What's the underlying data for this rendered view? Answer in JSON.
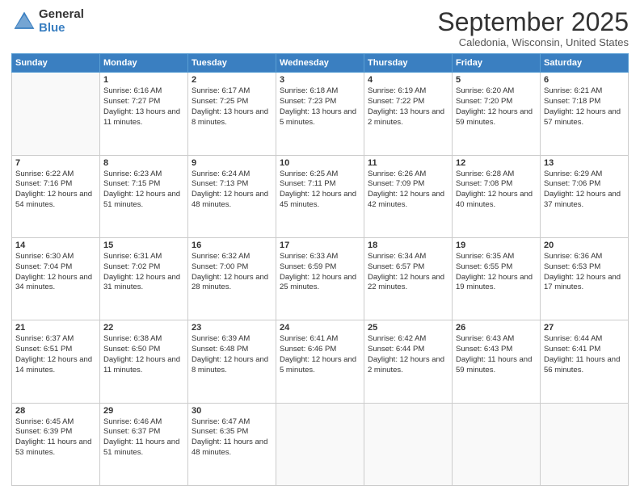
{
  "logo": {
    "general": "General",
    "blue": "Blue"
  },
  "title": "September 2025",
  "location": "Caledonia, Wisconsin, United States",
  "days_header": [
    "Sunday",
    "Monday",
    "Tuesday",
    "Wednesday",
    "Thursday",
    "Friday",
    "Saturday"
  ],
  "weeks": [
    [
      {
        "num": "",
        "sunrise": "",
        "sunset": "",
        "daylight": ""
      },
      {
        "num": "1",
        "sunrise": "Sunrise: 6:16 AM",
        "sunset": "Sunset: 7:27 PM",
        "daylight": "Daylight: 13 hours and 11 minutes."
      },
      {
        "num": "2",
        "sunrise": "Sunrise: 6:17 AM",
        "sunset": "Sunset: 7:25 PM",
        "daylight": "Daylight: 13 hours and 8 minutes."
      },
      {
        "num": "3",
        "sunrise": "Sunrise: 6:18 AM",
        "sunset": "Sunset: 7:23 PM",
        "daylight": "Daylight: 13 hours and 5 minutes."
      },
      {
        "num": "4",
        "sunrise": "Sunrise: 6:19 AM",
        "sunset": "Sunset: 7:22 PM",
        "daylight": "Daylight: 13 hours and 2 minutes."
      },
      {
        "num": "5",
        "sunrise": "Sunrise: 6:20 AM",
        "sunset": "Sunset: 7:20 PM",
        "daylight": "Daylight: 12 hours and 59 minutes."
      },
      {
        "num": "6",
        "sunrise": "Sunrise: 6:21 AM",
        "sunset": "Sunset: 7:18 PM",
        "daylight": "Daylight: 12 hours and 57 minutes."
      }
    ],
    [
      {
        "num": "7",
        "sunrise": "Sunrise: 6:22 AM",
        "sunset": "Sunset: 7:16 PM",
        "daylight": "Daylight: 12 hours and 54 minutes."
      },
      {
        "num": "8",
        "sunrise": "Sunrise: 6:23 AM",
        "sunset": "Sunset: 7:15 PM",
        "daylight": "Daylight: 12 hours and 51 minutes."
      },
      {
        "num": "9",
        "sunrise": "Sunrise: 6:24 AM",
        "sunset": "Sunset: 7:13 PM",
        "daylight": "Daylight: 12 hours and 48 minutes."
      },
      {
        "num": "10",
        "sunrise": "Sunrise: 6:25 AM",
        "sunset": "Sunset: 7:11 PM",
        "daylight": "Daylight: 12 hours and 45 minutes."
      },
      {
        "num": "11",
        "sunrise": "Sunrise: 6:26 AM",
        "sunset": "Sunset: 7:09 PM",
        "daylight": "Daylight: 12 hours and 42 minutes."
      },
      {
        "num": "12",
        "sunrise": "Sunrise: 6:28 AM",
        "sunset": "Sunset: 7:08 PM",
        "daylight": "Daylight: 12 hours and 40 minutes."
      },
      {
        "num": "13",
        "sunrise": "Sunrise: 6:29 AM",
        "sunset": "Sunset: 7:06 PM",
        "daylight": "Daylight: 12 hours and 37 minutes."
      }
    ],
    [
      {
        "num": "14",
        "sunrise": "Sunrise: 6:30 AM",
        "sunset": "Sunset: 7:04 PM",
        "daylight": "Daylight: 12 hours and 34 minutes."
      },
      {
        "num": "15",
        "sunrise": "Sunrise: 6:31 AM",
        "sunset": "Sunset: 7:02 PM",
        "daylight": "Daylight: 12 hours and 31 minutes."
      },
      {
        "num": "16",
        "sunrise": "Sunrise: 6:32 AM",
        "sunset": "Sunset: 7:00 PM",
        "daylight": "Daylight: 12 hours and 28 minutes."
      },
      {
        "num": "17",
        "sunrise": "Sunrise: 6:33 AM",
        "sunset": "Sunset: 6:59 PM",
        "daylight": "Daylight: 12 hours and 25 minutes."
      },
      {
        "num": "18",
        "sunrise": "Sunrise: 6:34 AM",
        "sunset": "Sunset: 6:57 PM",
        "daylight": "Daylight: 12 hours and 22 minutes."
      },
      {
        "num": "19",
        "sunrise": "Sunrise: 6:35 AM",
        "sunset": "Sunset: 6:55 PM",
        "daylight": "Daylight: 12 hours and 19 minutes."
      },
      {
        "num": "20",
        "sunrise": "Sunrise: 6:36 AM",
        "sunset": "Sunset: 6:53 PM",
        "daylight": "Daylight: 12 hours and 17 minutes."
      }
    ],
    [
      {
        "num": "21",
        "sunrise": "Sunrise: 6:37 AM",
        "sunset": "Sunset: 6:51 PM",
        "daylight": "Daylight: 12 hours and 14 minutes."
      },
      {
        "num": "22",
        "sunrise": "Sunrise: 6:38 AM",
        "sunset": "Sunset: 6:50 PM",
        "daylight": "Daylight: 12 hours and 11 minutes."
      },
      {
        "num": "23",
        "sunrise": "Sunrise: 6:39 AM",
        "sunset": "Sunset: 6:48 PM",
        "daylight": "Daylight: 12 hours and 8 minutes."
      },
      {
        "num": "24",
        "sunrise": "Sunrise: 6:41 AM",
        "sunset": "Sunset: 6:46 PM",
        "daylight": "Daylight: 12 hours and 5 minutes."
      },
      {
        "num": "25",
        "sunrise": "Sunrise: 6:42 AM",
        "sunset": "Sunset: 6:44 PM",
        "daylight": "Daylight: 12 hours and 2 minutes."
      },
      {
        "num": "26",
        "sunrise": "Sunrise: 6:43 AM",
        "sunset": "Sunset: 6:43 PM",
        "daylight": "Daylight: 11 hours and 59 minutes."
      },
      {
        "num": "27",
        "sunrise": "Sunrise: 6:44 AM",
        "sunset": "Sunset: 6:41 PM",
        "daylight": "Daylight: 11 hours and 56 minutes."
      }
    ],
    [
      {
        "num": "28",
        "sunrise": "Sunrise: 6:45 AM",
        "sunset": "Sunset: 6:39 PM",
        "daylight": "Daylight: 11 hours and 53 minutes."
      },
      {
        "num": "29",
        "sunrise": "Sunrise: 6:46 AM",
        "sunset": "Sunset: 6:37 PM",
        "daylight": "Daylight: 11 hours and 51 minutes."
      },
      {
        "num": "30",
        "sunrise": "Sunrise: 6:47 AM",
        "sunset": "Sunset: 6:35 PM",
        "daylight": "Daylight: 11 hours and 48 minutes."
      },
      {
        "num": "",
        "sunrise": "",
        "sunset": "",
        "daylight": ""
      },
      {
        "num": "",
        "sunrise": "",
        "sunset": "",
        "daylight": ""
      },
      {
        "num": "",
        "sunrise": "",
        "sunset": "",
        "daylight": ""
      },
      {
        "num": "",
        "sunrise": "",
        "sunset": "",
        "daylight": ""
      }
    ]
  ]
}
